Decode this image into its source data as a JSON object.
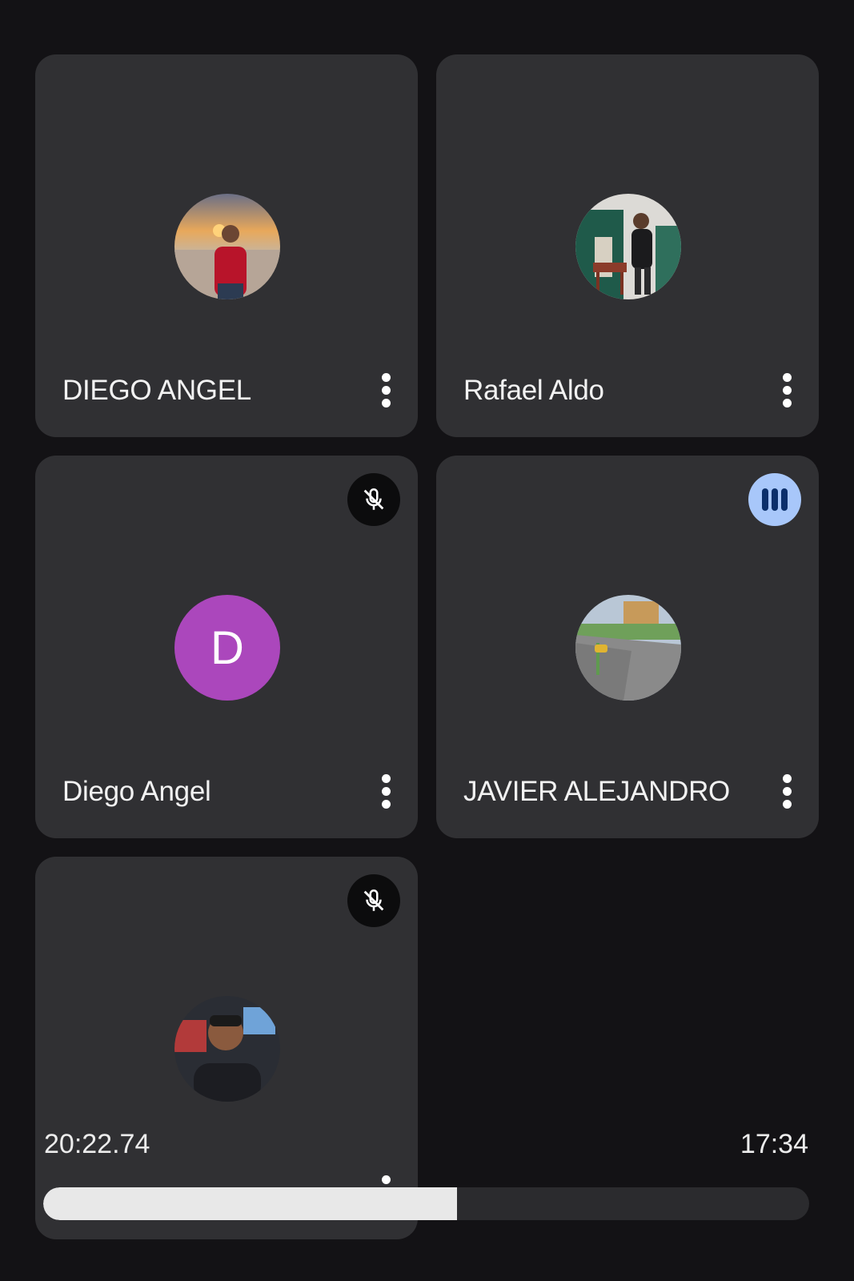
{
  "participants": [
    {
      "name": "DIEGO ANGEL",
      "avatar": "photo",
      "avatar_icon": "beach-sunset-photo",
      "status": "none"
    },
    {
      "name": "Rafael Aldo",
      "avatar": "photo",
      "avatar_icon": "indoor-person-photo",
      "status": "none"
    },
    {
      "name": "Diego Angel",
      "avatar": "letter",
      "avatar_letter": "D",
      "avatar_color": "#ab47bc",
      "status": "muted"
    },
    {
      "name": "JAVIER ALEJANDRO",
      "avatar": "photo",
      "avatar_icon": "street-photo",
      "status": "speaking"
    },
    {
      "name": "",
      "avatar": "photo",
      "avatar_icon": "portrait-photo",
      "status": "muted"
    }
  ],
  "media": {
    "elapsed": "20:22.74",
    "remaining": "17:34",
    "progress_fraction": 0.54
  },
  "colors": {
    "background": "#131215",
    "tile": "#303033",
    "speaking_badge": "#a8c7fa",
    "progress_fill": "#e8e8e8"
  },
  "icons": {
    "more": "more-vert-icon",
    "muted": "mic-off-icon",
    "speaking": "audio-level-icon"
  }
}
